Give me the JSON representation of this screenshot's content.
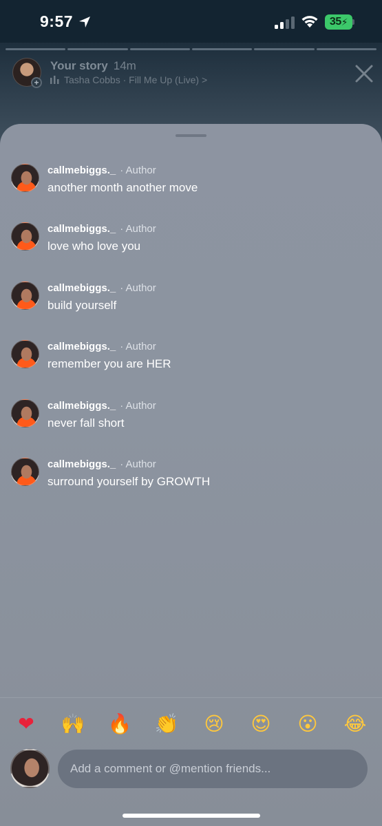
{
  "status_bar": {
    "time": "9:57",
    "battery_level": "35"
  },
  "story_header": {
    "title": "Your story",
    "time_ago": "14m",
    "music": "Tasha Cobbs · Fill Me Up (Live) >",
    "progress_segments": 6
  },
  "comments": [
    {
      "username": "callmebiggs._",
      "badge": "· Author",
      "text": "another month another move"
    },
    {
      "username": "callmebiggs._",
      "badge": "· Author",
      "text": "love who love you"
    },
    {
      "username": "callmebiggs._",
      "badge": "· Author",
      "text": "build yourself"
    },
    {
      "username": "callmebiggs._",
      "badge": "· Author",
      "text": "remember you are HER"
    },
    {
      "username": "callmebiggs._",
      "badge": "· Author",
      "text": "never fall short"
    },
    {
      "username": "callmebiggs._",
      "badge": "· Author",
      "text": "surround yourself by GROWTH"
    }
  ],
  "reactions": [
    {
      "name": "red-heart",
      "glyph": "❤",
      "color": "#e8223a"
    },
    {
      "name": "raising-hands",
      "glyph": "🙌",
      "color": "#ffc83d"
    },
    {
      "name": "fire",
      "glyph": "🔥",
      "color": "#ff6a1a"
    },
    {
      "name": "clapping-hands",
      "glyph": "👏",
      "color": "#ffc83d"
    },
    {
      "name": "crying-face",
      "glyph": "😢",
      "color": "#ffc83d"
    },
    {
      "name": "heart-eyes",
      "glyph": "😍",
      "color": "#ffc83d"
    },
    {
      "name": "surprised-face",
      "glyph": "😮",
      "color": "#ffc83d"
    },
    {
      "name": "laughing-tears",
      "glyph": "😂",
      "color": "#ffc83d"
    }
  ],
  "composer": {
    "placeholder": "Add a comment or @mention friends..."
  },
  "colors": {
    "sheet": "#8d94a1",
    "battery": "#3cc86a",
    "input": "#6b7380"
  }
}
